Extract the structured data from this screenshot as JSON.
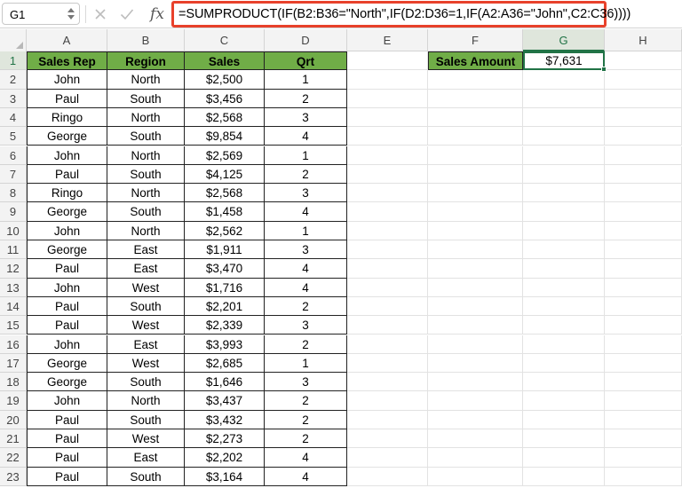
{
  "formula_bar": {
    "name_box": "G1",
    "fx_label": "fx",
    "formula": "=SUMPRODUCT(IF(B2:B36=\"North\",IF(D2:D36=1,IF(A2:A36=\"John\",C2:C36))))"
  },
  "selected_cell": "G1",
  "columns": [
    "A",
    "B",
    "C",
    "D",
    "E",
    "F",
    "G",
    "H"
  ],
  "table": {
    "headers": [
      "Sales Rep",
      "Region",
      "Sales",
      "Qrt"
    ],
    "rows": [
      [
        "John",
        "North",
        "$2,500",
        "1"
      ],
      [
        "Paul",
        "South",
        "$3,456",
        "2"
      ],
      [
        "Ringo",
        "North",
        "$2,568",
        "3"
      ],
      [
        "George",
        "South",
        "$9,854",
        "4"
      ],
      [
        "John",
        "North",
        "$2,569",
        "1"
      ],
      [
        "Paul",
        "South",
        "$4,125",
        "2"
      ],
      [
        "Ringo",
        "North",
        "$2,568",
        "3"
      ],
      [
        "George",
        "South",
        "$1,458",
        "4"
      ],
      [
        "John",
        "North",
        "$2,562",
        "1"
      ],
      [
        "George",
        "East",
        "$1,911",
        "3"
      ],
      [
        "Paul",
        "East",
        "$3,470",
        "4"
      ],
      [
        "John",
        "West",
        "$1,716",
        "4"
      ],
      [
        "Paul",
        "South",
        "$2,201",
        "2"
      ],
      [
        "Paul",
        "West",
        "$2,339",
        "3"
      ],
      [
        "John",
        "East",
        "$3,993",
        "2"
      ],
      [
        "George",
        "West",
        "$2,685",
        "1"
      ],
      [
        "George",
        "South",
        "$1,646",
        "3"
      ],
      [
        "John",
        "North",
        "$3,437",
        "2"
      ],
      [
        "Paul",
        "South",
        "$3,432",
        "2"
      ],
      [
        "Paul",
        "West",
        "$2,273",
        "2"
      ],
      [
        "Paul",
        "East",
        "$2,202",
        "4"
      ],
      [
        "Paul",
        "South",
        "$3,164",
        "4"
      ]
    ]
  },
  "sales_amount": {
    "label": "Sales Amount",
    "value": "$7,631"
  },
  "colors": {
    "header_fill": "#70ad47",
    "highlight_border": "#e8412b",
    "selection": "#217346"
  }
}
